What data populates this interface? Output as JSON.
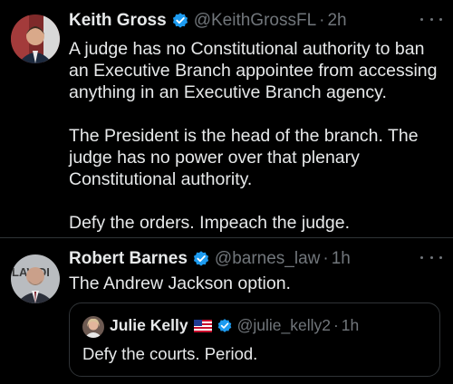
{
  "colors": {
    "background": "#000000",
    "text": "#e7e9ea",
    "secondary": "#71767b",
    "verified": "#1d9bf0",
    "divider": "#2f3336"
  },
  "icons": {
    "more": "more-options-icon",
    "verified": "verified-badge-icon",
    "flag": "us-flag-icon"
  },
  "tweets": [
    {
      "author_name": "Keith Gross",
      "handle": "@KeithGrossFL",
      "separator": "·",
      "time": "2h",
      "paragraphs": [
        "A judge has no Constitutional authority to ban an Executive Branch appointee from accessing anything in an Executive Branch agency.",
        "The President is the head of the branch. The judge has no power over that plenary Constitutional authority.",
        "Defy the orders. Impeach the judge."
      ]
    },
    {
      "author_name": "Robert Barnes",
      "handle": "@barnes_law",
      "separator": "·",
      "time": "1h",
      "text": "The Andrew Jackson option.",
      "avatar_text": "LAWDI",
      "quote": {
        "author_name": "Julie Kelly",
        "handle": "@julie_kelly2",
        "separator": "·",
        "time": "1h",
        "text": "Defy the courts. Period."
      }
    }
  ]
}
